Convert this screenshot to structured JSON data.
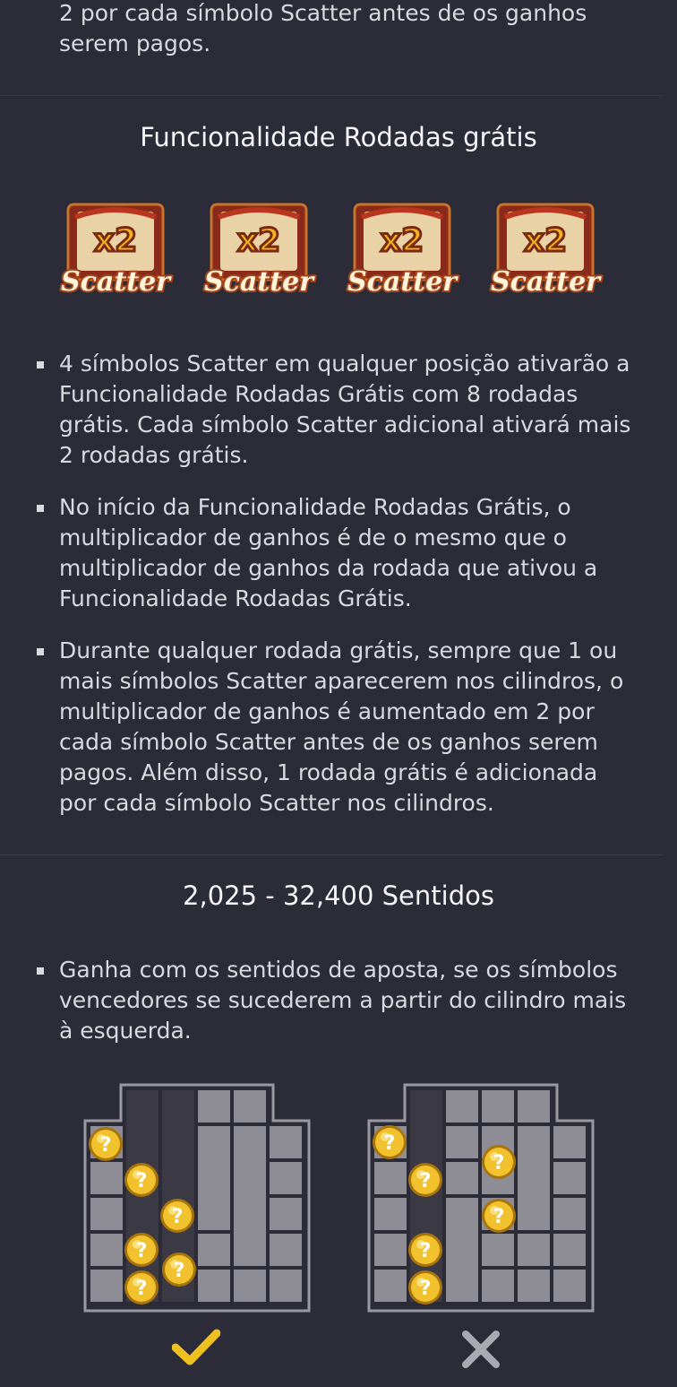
{
  "intro_text": "2 por cada símbolo Scatter antes de os ganhos serem pagos.",
  "free_spins": {
    "title": "Funcionalidade Rodadas grátis",
    "scatter_symbol": {
      "multiplier_text": "x2",
      "word_text": "Scatter",
      "count": 4
    },
    "bullets": [
      "4 símbolos Scatter em qualquer posição ativarão a Funcionalidade Rodadas Grátis com 8 rodadas grátis. Cada símbolo Scatter adicional ativará mais 2 rodadas grátis.",
      "No início da Funcionalidade Rodadas Grátis, o multiplicador de ganhos é de o mesmo que o multiplicador de ganhos da rodada que ativou a Funcionalidade Rodadas Grátis.",
      "Durante qualquer rodada grátis, sempre que 1 ou mais símbolos Scatter aparecerem nos cilindros, o multiplicador de ganhos é aumentado em 2 por cada símbolo Scatter antes de os ganhos serem pagos. Além disso, 1 rodada grátis é adicionada por cada símbolo Scatter nos cilindros."
    ]
  },
  "ways": {
    "title": "2,025 - 32,400 Sentidos",
    "bullets": [
      "Ganha com os sentidos de aposta, se os símbolos vencedores se sucederem a partir do cilindro mais à esquerda."
    ],
    "coin_glyph": "?",
    "examples": [
      {
        "result_icon": "check-icon",
        "color": "#f0c020"
      },
      {
        "result_icon": "cross-icon",
        "color": "#a9a9b2"
      }
    ]
  },
  "colors": {
    "background": "#2c2b38",
    "cell": "#8e8d96",
    "cell_highlight": "#3a3944",
    "coin": "#f2c12e"
  }
}
